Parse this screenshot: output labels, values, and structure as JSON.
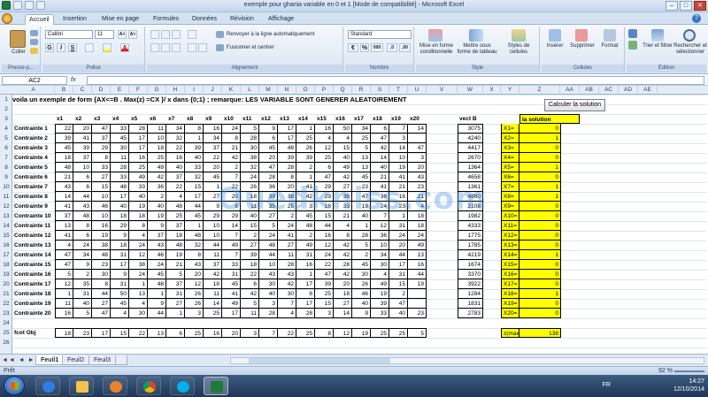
{
  "window": {
    "title": "exemple pour ghania variable en 0 et 1  [Mode de compatibilité] - Microsoft Excel"
  },
  "tabs": [
    "Accueil",
    "Insertion",
    "Mise en page",
    "Formules",
    "Données",
    "Révision",
    "Affichage"
  ],
  "ribbon": {
    "paste": "Coller",
    "clipboard": "Presse-p...",
    "font_name": "Calibri",
    "font_size": "11",
    "font_group": "Police",
    "wrap": "Renvoyer à la ligne automatiquement",
    "merge": "Fusionner et centrer",
    "align_group": "Alignement",
    "number_format": "Standard",
    "number_group": "Nombre",
    "cond_format": "Mise en forme conditionnelle",
    "table_format": "Mettre sous forme de tableau",
    "cell_styles": "Styles de cellules",
    "style_group": "Style",
    "insert": "Insérer",
    "delete": "Supprimer",
    "format": "Format",
    "cells_group": "Cellules",
    "sort": "Trier et filtrer",
    "find": "Rechercher et sélectionner",
    "edit_group": "Édition",
    "bold": "G",
    "italic": "I",
    "underline": "S",
    "font_grow": "A˄",
    "font_shrink": "A˅",
    "percent": "%",
    "thousands": "000",
    "dec_up": ",0",
    "dec_down": ",00"
  },
  "formula_bar": {
    "name_box": "AC2",
    "fx": "fx",
    "content": ""
  },
  "columns": [
    "A",
    "B",
    "C",
    "D",
    "E",
    "F",
    "G",
    "H",
    "I",
    "J",
    "K",
    "L",
    "M",
    "N",
    "O",
    "P",
    "Q",
    "R",
    "S",
    "T",
    "U",
    "V",
    "W",
    "X",
    "Y",
    "Z",
    "AA",
    "AB",
    "AC",
    "AD",
    "AE"
  ],
  "sheet": {
    "title": "voila un exemple de form {AX<=B  . Max(z) =CX }/ x dans {0;1} ; remarque: LES VARIABLE SONT GENERER ALEATOIREMENT",
    "button_label": "Calculer la solution",
    "var_headers": [
      "x1",
      "x2",
      "x3",
      "x4",
      "x5",
      "x6",
      "x7",
      "x8",
      "x9",
      "x10",
      "x11",
      "x12",
      "x13",
      "x14",
      "x15",
      "x16",
      "x17",
      "x18",
      "x19",
      "x20"
    ],
    "vect_label": "vect B",
    "solution_label": "la solution",
    "constraints": [
      {
        "label": "Contrainte 1",
        "values": [
          22,
          20,
          47,
          33,
          28,
          11,
          34,
          8,
          16,
          24,
          5,
          9,
          17,
          1,
          16,
          50,
          34,
          6,
          7,
          14
        ],
        "b": 3075
      },
      {
        "label": "Contrainte 2",
        "values": [
          39,
          41,
          37,
          45,
          17,
          10,
          32,
          1,
          34,
          8,
          28,
          6,
          17,
          25,
          4,
          4,
          25,
          47,
          3,
          ""
        ],
        "b": 4240
      },
      {
        "label": "Contrainte 3",
        "values": [
          45,
          39,
          29,
          30,
          17,
          18,
          22,
          39,
          37,
          21,
          30,
          45,
          48,
          26,
          12,
          15,
          5,
          42,
          14,
          47
        ],
        "b": 4417
      },
      {
        "label": "Contrainte 4",
        "values": [
          18,
          37,
          8,
          11,
          16,
          25,
          16,
          40,
          22,
          42,
          38,
          20,
          39,
          39,
          25,
          40,
          13,
          14,
          10,
          3
        ],
        "b": 2670
      },
      {
        "label": "Contrainte 5",
        "values": [
          48,
          10,
          33,
          28,
          25,
          49,
          40,
          33,
          20,
          2,
          32,
          47,
          28,
          2,
          6,
          49,
          13,
          40,
          19,
          20
        ],
        "b": 1364
      },
      {
        "label": "Contrainte 6",
        "values": [
          21,
          6,
          27,
          33,
          49,
          42,
          37,
          32,
          45,
          7,
          24,
          28,
          8,
          1,
          47,
          42,
          45,
          21,
          41,
          43
        ],
        "b": 4658
      },
      {
        "label": "Contrainte 7",
        "values": [
          43,
          6,
          15,
          48,
          33,
          36,
          22,
          15,
          1,
          22,
          26,
          36,
          20,
          41,
          29,
          27,
          23,
          41,
          21,
          23
        ],
        "b": 1361
      },
      {
        "label": "Contrainte 8",
        "values": [
          14,
          44,
          10,
          17,
          40,
          2,
          4,
          17,
          27,
          20,
          18,
          39,
          38,
          42,
          29,
          36,
          47,
          36,
          16,
          21
        ],
        "b": 4860
      },
      {
        "label": "Contrainte 9",
        "values": [
          41,
          43,
          46,
          40,
          19,
          40,
          48,
          44,
          9,
          8,
          11,
          35,
          25,
          3,
          18,
          33,
          19,
          24,
          23,
          4
        ],
        "b": 2108
      },
      {
        "label": "Contrainte 10",
        "values": [
          37,
          48,
          10,
          18,
          18,
          19,
          25,
          45,
          29,
          29,
          40,
          27,
          2,
          45,
          15,
          21,
          40,
          7,
          1,
          18
        ],
        "b": 1982
      },
      {
        "label": "Contrainte 11",
        "values": [
          13,
          8,
          16,
          29,
          8,
          9,
          37,
          1,
          10,
          14,
          15,
          5,
          24,
          48,
          44,
          4,
          1,
          12,
          31,
          18
        ],
        "b": 4333
      },
      {
        "label": "Contrainte 12",
        "values": [
          41,
          6,
          19,
          9,
          4,
          37,
          18,
          48,
          10,
          7,
          2,
          24,
          41,
          2,
          16,
          8,
          28,
          36,
          24,
          24
        ],
        "b": 1775
      },
      {
        "label": "Contrainte 13",
        "values": [
          4,
          24,
          38,
          18,
          24,
          43,
          48,
          32,
          44,
          49,
          27,
          48,
          27,
          49,
          12,
          42,
          5,
          10,
          20,
          49
        ],
        "b": 1785
      },
      {
        "label": "Contrainte 14",
        "values": [
          47,
          34,
          48,
          31,
          12,
          46,
          19,
          8,
          11,
          7,
          39,
          44,
          11,
          31,
          24,
          42,
          2,
          34,
          44,
          13
        ],
        "b": 4219
      },
      {
        "label": "Contrainte 15",
        "values": [
          47,
          9,
          23,
          17,
          38,
          24,
          21,
          43,
          37,
          33,
          18,
          10,
          28,
          16,
          22,
          28,
          45,
          30,
          17,
          16
        ],
        "b": 1674
      },
      {
        "label": "Contrainte 16",
        "values": [
          5,
          2,
          30,
          9,
          24,
          45,
          5,
          20,
          42,
          31,
          22,
          43,
          43,
          1,
          47,
          42,
          30,
          4,
          31,
          44
        ],
        "b": 3370
      },
      {
        "label": "Contrainte 17",
        "values": [
          12,
          35,
          8,
          31,
          1,
          48,
          37,
          12,
          18,
          45,
          6,
          30,
          42,
          17,
          39,
          20,
          26,
          49,
          15,
          19
        ],
        "b": 3922
      },
      {
        "label": "Contrainte 18",
        "values": [
          1,
          31,
          44,
          50,
          13,
          1,
          31,
          26,
          11,
          41,
          42,
          40,
          30,
          8,
          25,
          18,
          46,
          19,
          2,
          ""
        ],
        "b": 1284
      },
      {
        "label": "Contrainte 19",
        "values": [
          11,
          40,
          27,
          45,
          4,
          9,
          27,
          26,
          14,
          49,
          5,
          3,
          7,
          17,
          15,
          27,
          40,
          39,
          47,
          ""
        ],
        "b": 1831
      },
      {
        "label": "Contrainte 20",
        "values": [
          16,
          5,
          47,
          4,
          30,
          44,
          1,
          3,
          25,
          17,
          11,
          28,
          4,
          28,
          3,
          14,
          9,
          33,
          40,
          23
        ],
        "b": 2783
      }
    ],
    "solution": [
      {
        "var": "X1=",
        "val": 0
      },
      {
        "var": "X2=",
        "val": 1
      },
      {
        "var": "X3=",
        "val": 0
      },
      {
        "var": "X4=",
        "val": 0
      },
      {
        "var": "X5=",
        "val": 1
      },
      {
        "var": "X6=",
        "val": 0
      },
      {
        "var": "X7=",
        "val": 1
      },
      {
        "var": "X8=",
        "val": 1
      },
      {
        "var": "X9=",
        "val": 0
      },
      {
        "var": "X10=",
        "val": 0
      },
      {
        "var": "X11=",
        "val": 0
      },
      {
        "var": "X12=",
        "val": 0
      },
      {
        "var": "X13=",
        "val": 0
      },
      {
        "var": "X14=",
        "val": 1
      },
      {
        "var": "X15=",
        "val": 0
      },
      {
        "var": "X16=",
        "val": 0
      },
      {
        "var": "X17=",
        "val": 0
      },
      {
        "var": "X18=",
        "val": 1
      },
      {
        "var": "X19=",
        "val": 0
      },
      {
        "var": "X20=",
        "val": 0
      }
    ],
    "obj_label": "fcot Obj",
    "obj_values": [
      18,
      23,
      17,
      15,
      22,
      13,
      6,
      25,
      16,
      20,
      3,
      7,
      22,
      25,
      8,
      12,
      19,
      25,
      25,
      5
    ],
    "zmax_label": "z(max)",
    "zmax_value": 138
  },
  "sheet_tabs": [
    "Feuil1",
    "Feuil2",
    "Feuil3"
  ],
  "status": {
    "ready": "Prêt",
    "zoom": "92 %"
  },
  "taskbar": {
    "lang": "FR",
    "time": "14:27",
    "date": "12/10/2014"
  },
  "watermark": "Ouedkniss.com"
}
